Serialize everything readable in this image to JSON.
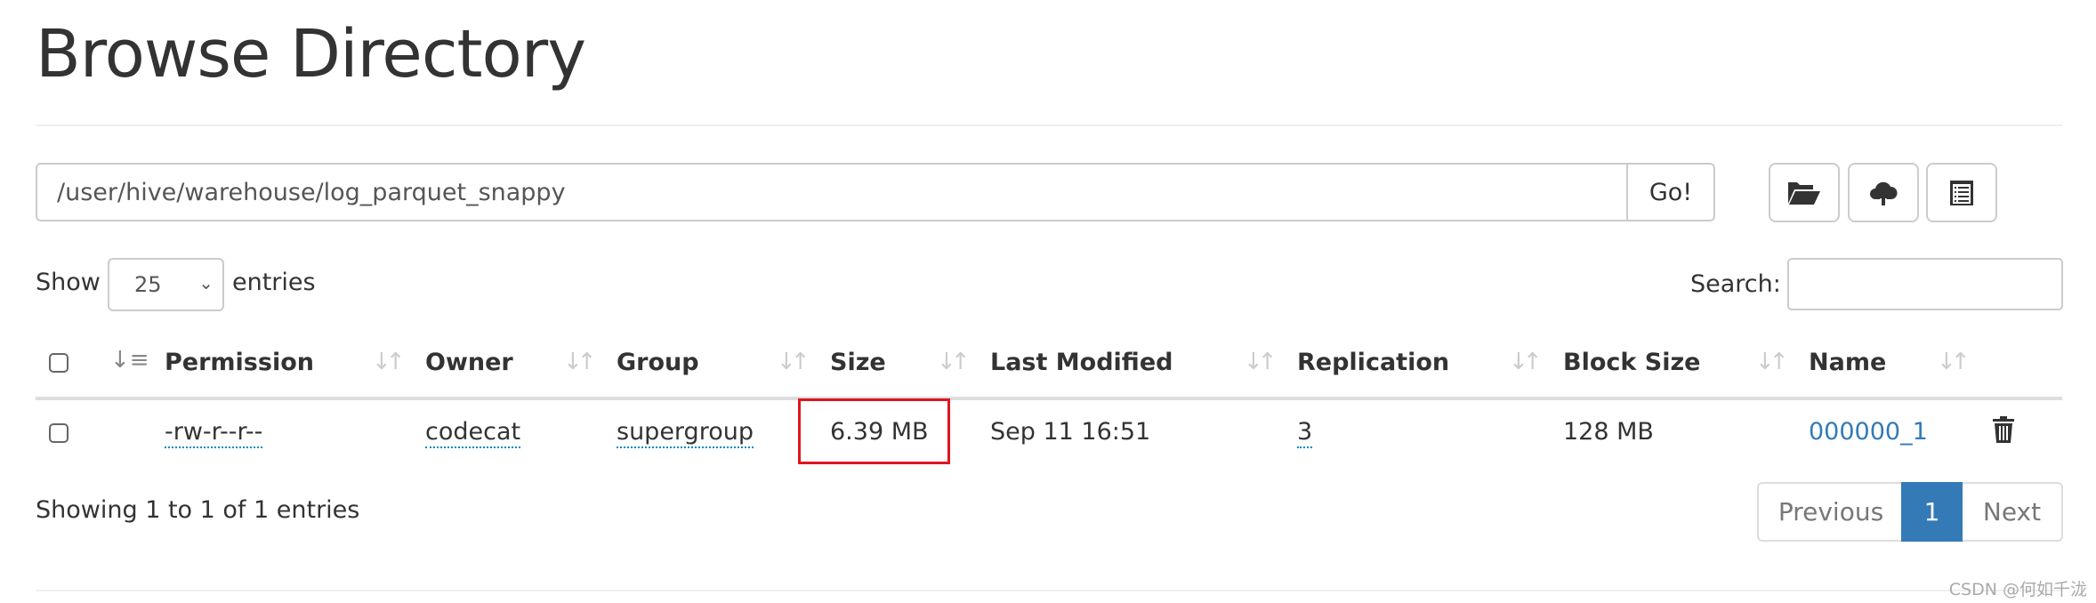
{
  "title": "Browse Directory",
  "path_input": {
    "value": "/user/hive/warehouse/log_parquet_snappy"
  },
  "go_label": "Go!",
  "toolbar": {
    "icons": [
      "folder-open-icon",
      "cloud-upload-icon",
      "list-icon"
    ]
  },
  "length": {
    "show": "Show",
    "value": "25",
    "entries": "entries"
  },
  "search": {
    "label": "Search:",
    "value": ""
  },
  "columns": [
    "Permission",
    "Owner",
    "Group",
    "Size",
    "Last Modified",
    "Replication",
    "Block Size",
    "Name"
  ],
  "rows": [
    {
      "permission": "-rw-r--r--",
      "owner": "codecat",
      "group": "supergroup",
      "size": "6.39 MB",
      "modified": "Sep 11 16:51",
      "replication": "3",
      "block_size": "128 MB",
      "name": "000000_1"
    }
  ],
  "footer": {
    "info": "Showing 1 to 1 of 1 entries"
  },
  "pagination": {
    "previous": "Previous",
    "current": "1",
    "next": "Next"
  },
  "highlight_color": "#e0141e",
  "accent": "#337ab7",
  "watermark": "CSDN @何如千泷"
}
